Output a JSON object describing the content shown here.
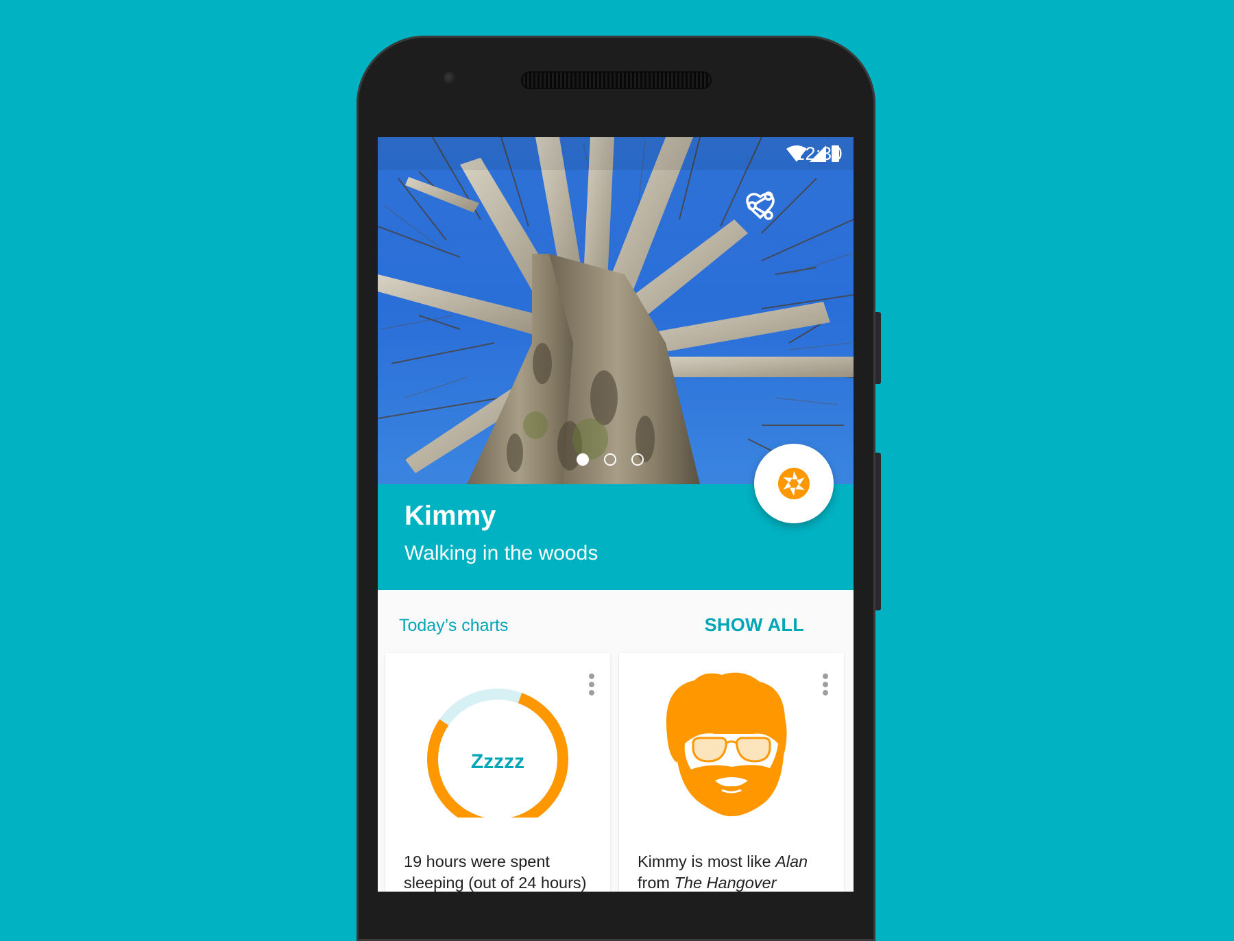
{
  "status_bar": {
    "time": "12:30",
    "icons": [
      "wifi-icon",
      "signal-icon",
      "battery-icon"
    ]
  },
  "hero": {
    "actions": [
      "heart-icon",
      "share-icon"
    ],
    "carousel": {
      "count": 3,
      "active_index": 0
    }
  },
  "profile": {
    "name": "Kimmy",
    "activity": "Walking in the woods"
  },
  "fab": {
    "icon": "camera-shutter-icon"
  },
  "charts_section": {
    "title": "Today’s charts",
    "show_all": "SHOW ALL"
  },
  "cards": [
    {
      "center_text": "Zzzzz",
      "text_line1": "19 hours were spent",
      "text_line2": "sleeping (out of 24 hours)",
      "sleep_fraction": 0.79
    },
    {
      "line1_prefix": "Kimmy is most like ",
      "line1_em": "Alan",
      "line2_prefix": "from ",
      "line2_em": "The Hangover",
      "icon": "bearded-man-sunglasses-icon"
    }
  ],
  "colors": {
    "background": "#00B2C2",
    "accent": "#00A6B8",
    "orange": "#FF9800",
    "ring_remainder": "#D6F0F3"
  }
}
